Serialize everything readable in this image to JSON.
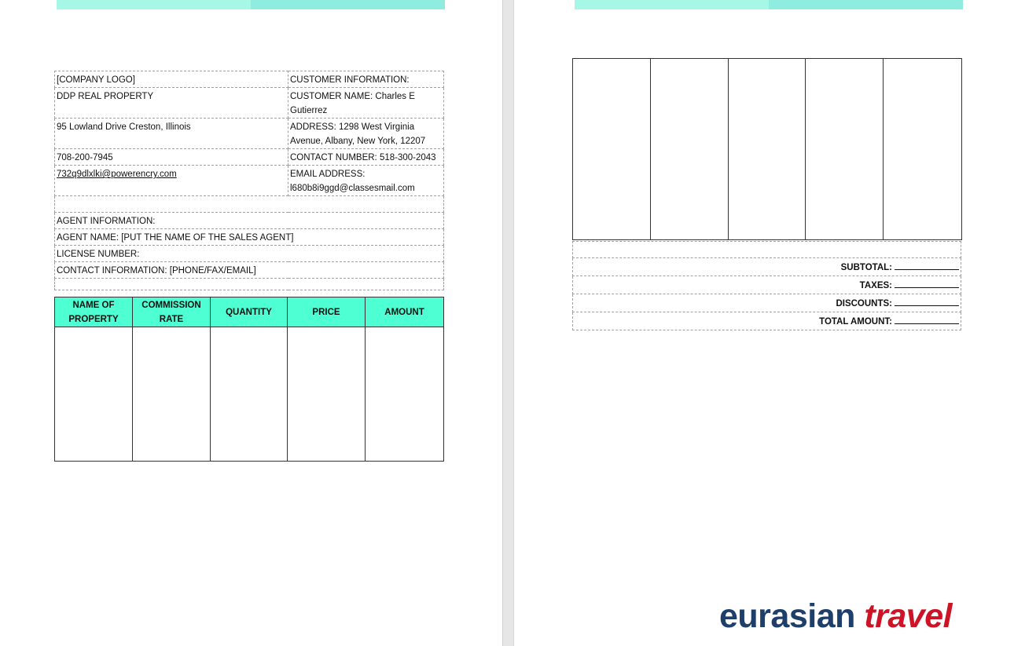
{
  "colors": {
    "header_light": "#a6f7e6",
    "header_dark": "#8fede0",
    "table_header_bg": "#4dffd2",
    "brand_blue": "#1f3f6b",
    "brand_red": "#cc1426"
  },
  "company": {
    "logo_placeholder": "[COMPANY LOGO]",
    "name": "DDP REAL PROPERTY",
    "address": "95 Lowland Drive Creston, Illinois",
    "phone": "708-200-7945",
    "email": "732q9dlxlki@powerencry.com"
  },
  "customer": {
    "heading": "CUSTOMER INFORMATION:",
    "name": "CUSTOMER NAME: Charles E Gutierrez",
    "address": "ADDRESS: 1298 West Virginia Avenue, Albany, New York, 12207",
    "contact": "CONTACT NUMBER: 518-300-2043",
    "email": "EMAIL ADDRESS: l680b8i9ggd@classesmail.com"
  },
  "agent": {
    "heading": "AGENT INFORMATION:",
    "name": "AGENT NAME: [PUT THE NAME OF THE SALES AGENT]",
    "license": "LICENSE NUMBER:",
    "contact": "CONTACT INFORMATION: [PHONE/FAX/EMAIL]"
  },
  "items_table": {
    "headers": [
      "NAME OF PROPERTY",
      "COMMISSION RATE",
      "QUANTITY",
      "PRICE",
      "AMOUNT"
    ]
  },
  "totals": {
    "subtotal": "SUBTOTAL:",
    "taxes": "TAXES:",
    "discounts": "DISCOUNTS:",
    "total": "TOTAL AMOUNT:"
  },
  "brand": {
    "word1": "eurasian",
    "word2": "travel"
  }
}
